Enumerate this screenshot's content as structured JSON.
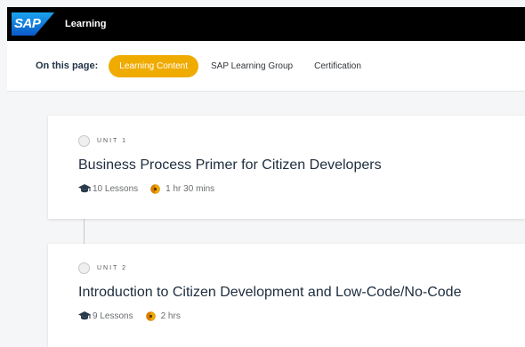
{
  "header": {
    "logo_text": "SAP",
    "app_title": "Learning",
    "brand_color": "#0070f2"
  },
  "page_nav": {
    "label": "On this page:",
    "items": [
      {
        "label": "Learning Content",
        "active": true
      },
      {
        "label": "SAP Learning Group",
        "active": false
      },
      {
        "label": "Certification",
        "active": false
      }
    ],
    "active_color": "#f0ab00"
  },
  "units": [
    {
      "unit_label": "UNIT 1",
      "title": "Business Process Primer for Citizen Developers",
      "lessons": "10 Lessons",
      "duration": "1 hr 30 mins"
    },
    {
      "unit_label": "UNIT 2",
      "title": "Introduction to Citizen Development and Low-Code/No-Code",
      "lessons": "9 Lessons",
      "duration": "2 hrs"
    }
  ],
  "icons": {
    "lessons": "graduation-cap-icon",
    "duration": "clock-icon",
    "status": "unit-status-circle-icon"
  }
}
